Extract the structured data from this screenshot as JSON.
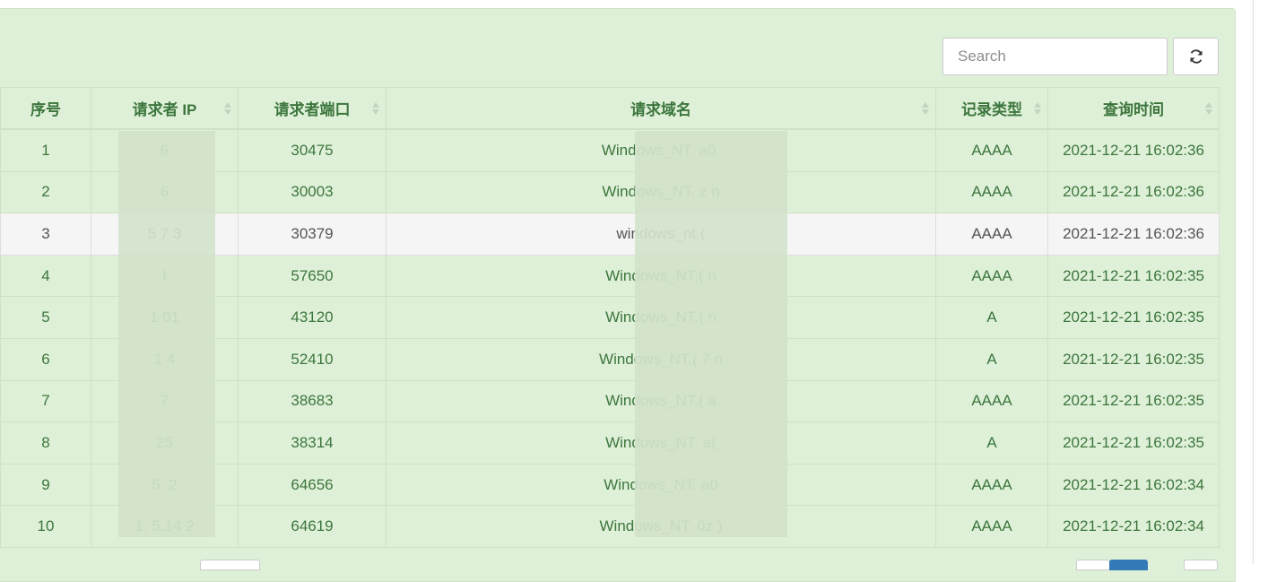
{
  "toolbar": {
    "search_placeholder": "Search"
  },
  "table": {
    "columns": [
      "序号",
      "请求者 IP",
      "请求者端口",
      "请求域名",
      "记录类型",
      "查询时间"
    ],
    "rows": [
      {
        "no": "1",
        "ip": "6",
        "port": "30475",
        "domain": "Windows_NT.   a0.",
        "type": "AAAA",
        "time": "2021-12-21 16:02:36"
      },
      {
        "no": "2",
        "ip": "6",
        "port": "30003",
        "domain": "Windows_NT.   z   n",
        "type": "AAAA",
        "time": "2021-12-21 16:02:36"
      },
      {
        "no": "3",
        "ip": "5   7   3",
        "port": "30379",
        "domain": "windows_nt.(",
        "type": "AAAA",
        "time": "2021-12-21 16:02:36"
      },
      {
        "no": "4",
        "ip": "l",
        "port": "57650",
        "domain": "Windows_NT.(   n",
        "type": "AAAA",
        "time": "2021-12-21 16:02:35"
      },
      {
        "no": "5",
        "ip": "1   01",
        "port": "43120",
        "domain": "Windows_NT.(   n",
        "type": "A",
        "time": "2021-12-21 16:02:35"
      },
      {
        "no": "6",
        "ip": "1   4",
        "port": "52410",
        "domain": "Windows_NT.(   7   n",
        "type": "A",
        "time": "2021-12-21 16:02:35"
      },
      {
        "no": "7",
        "ip": "7",
        "port": "38683",
        "domain": "Windows_NT.(   a",
        "type": "AAAA",
        "time": "2021-12-21 16:02:35"
      },
      {
        "no": "8",
        "ip": "25",
        "port": "38314",
        "domain": "Windows_NT.   a(",
        "type": "A",
        "time": "2021-12-21 16:02:35"
      },
      {
        "no": "9",
        "ip": "5.   2",
        "port": "64656",
        "domain": "Windows_NT.   a0",
        "type": "AAAA",
        "time": "2021-12-21 16:02:34"
      },
      {
        "no": "10",
        "ip": "1.   5.14   2",
        "port": "64619",
        "domain": "Windows_NT.   0z   )",
        "type": "AAAA",
        "time": "2021-12-21 16:02:34"
      }
    ]
  }
}
